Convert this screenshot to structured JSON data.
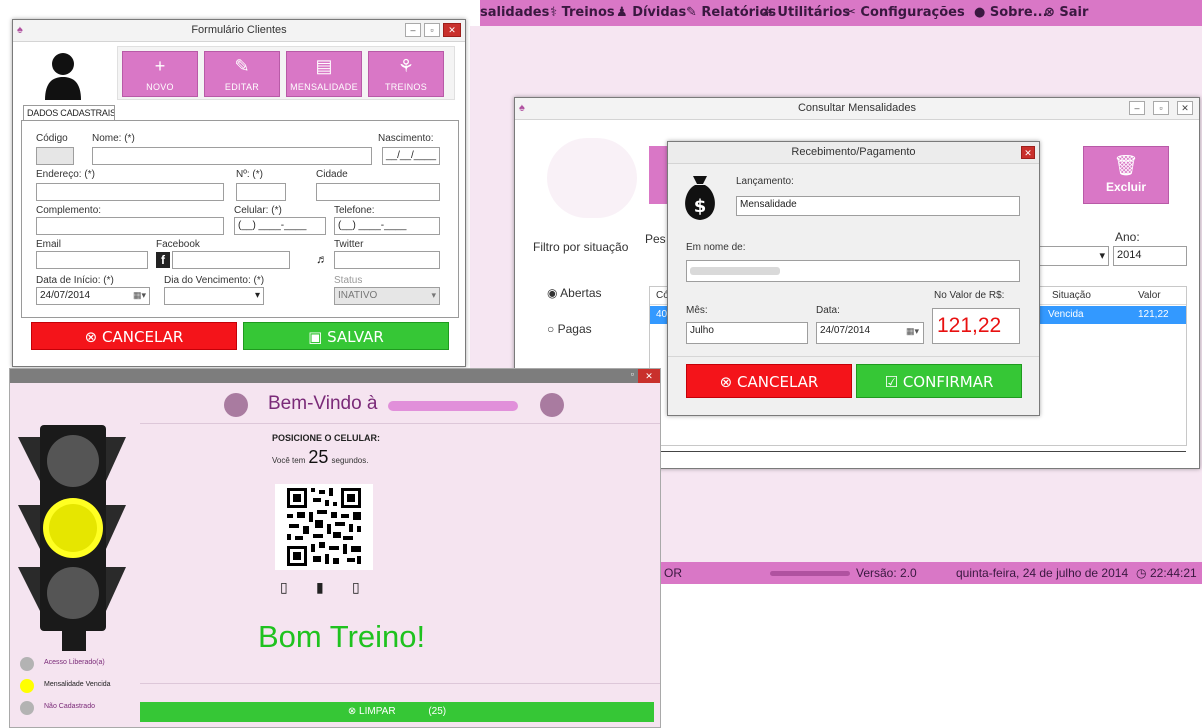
{
  "main_menu": {
    "items": [
      {
        "icon": "money-icon",
        "glyph": "",
        "label": "salidades"
      },
      {
        "icon": "dumbbell-icon",
        "glyph": "⚕",
        "label": "Treinos"
      },
      {
        "icon": "bag-icon",
        "glyph": "♟",
        "label": "Dívidas"
      },
      {
        "icon": "report-icon",
        "glyph": "✎",
        "label": "Relatórios"
      },
      {
        "icon": "tools-icon",
        "glyph": "✲",
        "label": "Utilitários"
      },
      {
        "icon": "wrench-icon",
        "glyph": "✂",
        "label": "Configurações"
      },
      {
        "icon": "info-icon",
        "glyph": "●",
        "label": "Sobre..."
      },
      {
        "icon": "exit-icon",
        "glyph": "⊗",
        "label": "Sair"
      }
    ]
  },
  "status_bar": {
    "left_text": "OR",
    "version": "Versão: 2.0",
    "date": "quinta-feira, 24 de julho de 2014",
    "time": "22:44:21"
  },
  "clientes": {
    "title": "Formulário Clientes",
    "toolbar": {
      "novo": "NOVO",
      "editar": "EDITAR",
      "mensalidade": "MENSALIDADE",
      "treinos": "TREINOS"
    },
    "tab_label": "DADOS CADASTRAIS",
    "labels": {
      "codigo": "Código",
      "nome": "Nome: (*)",
      "nascimento": "Nascimento:",
      "endereco": "Endereço: (*)",
      "numero": "Nº: (*)",
      "cidade": "Cidade",
      "complemento": "Complemento:",
      "celular": "Celular: (*)",
      "telefone": "Telefone:",
      "email": "Email",
      "facebook": "Facebook",
      "twitter": "Twitter",
      "data_inicio": "Data de Início: (*)",
      "dia_vencimento": "Dia do Vencimento: (*)",
      "status": "Status"
    },
    "values": {
      "nascimento": "__/__/____",
      "celular": "(__) ____-____",
      "telefone": "(__) ____-____",
      "data_inicio": "24/07/2014",
      "status": "INATIVO"
    },
    "buttons": {
      "cancelar": "CANCELAR",
      "salvar": "SALVAR"
    }
  },
  "mensalidades": {
    "title": "Consultar Mensalidades",
    "excluir": "Excluir",
    "filtro": {
      "title": "Filtro por situação",
      "abertas": "Abertas",
      "pagas": "Pagas"
    },
    "pes_label": "Pes",
    "ano_label": "Ano:",
    "ano_value": "2014",
    "table": {
      "headers": [
        "Có",
        "Situação",
        "Valor"
      ],
      "row": [
        "40",
        "Vencida",
        "121,22"
      ]
    }
  },
  "recebimento": {
    "title": "Recebimento/Pagamento",
    "lancamento_label": "Lançamento:",
    "lancamento_value": "Mensalidade",
    "em_nome_label": "Em nome de:",
    "mes_label": "Mês:",
    "mes_value": "Julho",
    "data_label": "Data:",
    "data_value": "24/07/2014",
    "valor_label": "No Valor de R$:",
    "valor_value": "121,22",
    "cancelar": "CANCELAR",
    "confirmar": "CONFIRMAR"
  },
  "bemvindo": {
    "title": "Bem-Vindo à",
    "posicione": "POSICIONE O CELULAR:",
    "voce_tem": "Você tem",
    "seconds": "25",
    "segundos": "segundos.",
    "bom_treino": "Bom Treino!",
    "legend": [
      "Acesso Liberado(a)",
      "Mensalidade Vencida",
      "Não Cadastrado"
    ],
    "legend_colors": [
      "#b3b3b3",
      "#ffff00",
      "#b3b3b3"
    ],
    "limpar": "LIMPAR",
    "limpar_count": "(25)",
    "active_light": "yellow"
  }
}
